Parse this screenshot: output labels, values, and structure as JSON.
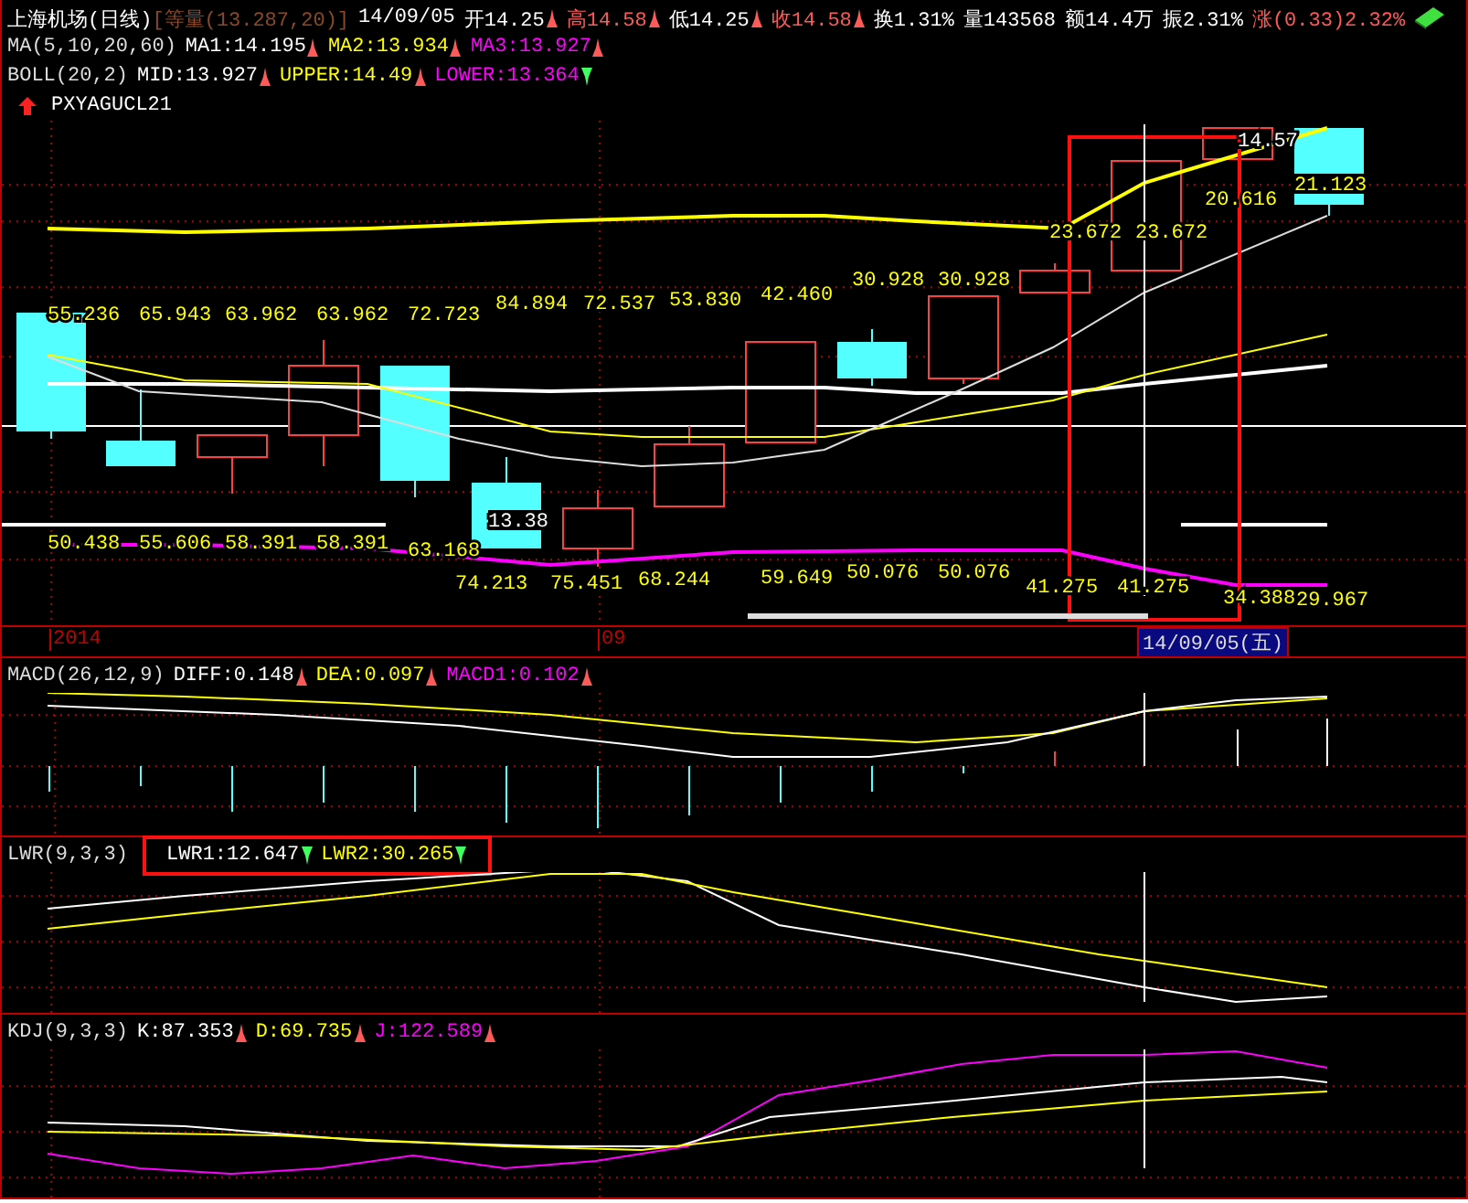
{
  "header": {
    "stock": "上海机场",
    "period": "(日线)",
    "mode": "[等量(13.287,20)]",
    "date": "14/09/05",
    "quotes": [
      {
        "label": "开",
        "value": "14.25",
        "color": "#ffffff",
        "arrow": true
      },
      {
        "label": "高",
        "value": "14.58",
        "color": "#ff5a5a",
        "arrow": true
      },
      {
        "label": "低",
        "value": "14.25",
        "color": "#ffffff",
        "arrow": true
      },
      {
        "label": "收",
        "value": "14.58",
        "color": "#ff5a5a",
        "arrow": true
      },
      {
        "label": "换",
        "value": "1.31%",
        "color": "#ffffff",
        "arrow": false
      },
      {
        "label": "量",
        "value": "143568",
        "color": "#ffffff",
        "arrow": false
      },
      {
        "label": "额",
        "value": "14.4万",
        "color": "#ffffff",
        "arrow": false
      },
      {
        "label": "振",
        "value": "2.31%",
        "color": "#ffffff",
        "arrow": false
      },
      {
        "label": "涨",
        "value": "(0.33)2.32%",
        "color": "#ff5a5a",
        "arrow": false
      }
    ]
  },
  "legends": [
    {
      "title": "MA(5,10,20,60)",
      "values": [
        {
          "label": "MA1:14.195",
          "color": "#ffffff",
          "rising": true
        },
        {
          "label": "MA2:13.934",
          "color": "#ffff00",
          "rising": true
        },
        {
          "label": "MA3:13.927",
          "color": "#ff00ff",
          "rising": true
        }
      ]
    },
    {
      "title": "BOLL(20,2)",
      "values": [
        {
          "label": "MID:13.927",
          "color": "#ffffff",
          "rising": true
        },
        {
          "label": "UPPER:14.49",
          "color": "#ffff00",
          "rising": true
        },
        {
          "label": "LOWER:13.364",
          "color": "#ff00ff",
          "rising": false
        }
      ]
    }
  ],
  "signal": {
    "label": "PXYAGUCL21"
  },
  "chart": {
    "upper_labels": [
      "55.236",
      "65.943",
      "63.962",
      "63.962",
      "72.723",
      "84.894",
      "72.537",
      "53.830",
      "42.460",
      "30.928",
      "30.928",
      "23.672",
      "23.672",
      "20.616",
      "21.123"
    ],
    "lower_labels": [
      "50.438",
      "55.606",
      "58.391",
      "58.391",
      "63.168",
      "74.213",
      "75.451",
      "68.244",
      "59.649",
      "50.076",
      "50.076",
      "41.275",
      "41.275",
      "34.388",
      "29.967"
    ],
    "extra_labels": [
      "13.38",
      "14.57"
    ]
  },
  "axis": {
    "labels": [
      "2014",
      "09"
    ],
    "cursor_date": "14/09/05(五)"
  },
  "panes": [
    {
      "kind": "macd",
      "title": "MACD(26,12,9)",
      "highlighted": false,
      "values": [
        {
          "label": "DIFF:0.148",
          "color": "#ffffff",
          "rising": true
        },
        {
          "label": "DEA:0.097",
          "color": "#ffff00",
          "rising": true
        },
        {
          "label": "MACD1:0.102",
          "color": "#ff00ff",
          "rising": true
        }
      ]
    },
    {
      "kind": "lwr",
      "title": "LWR(9,3,3)",
      "highlighted": true,
      "values": [
        {
          "label": "LWR1:12.647",
          "color": "#ffffff",
          "rising": false
        },
        {
          "label": "LWR2:30.265",
          "color": "#ffff00",
          "rising": false
        }
      ]
    },
    {
      "kind": "kdj",
      "title": "KDJ(9,3,3)",
      "highlighted": false,
      "values": [
        {
          "label": "K:87.353",
          "color": "#ffffff",
          "rising": true
        },
        {
          "label": "D:69.735",
          "color": "#ffff00",
          "rising": true
        },
        {
          "label": "J:122.589",
          "color": "#ff00ff",
          "rising": true
        }
      ]
    }
  ]
}
